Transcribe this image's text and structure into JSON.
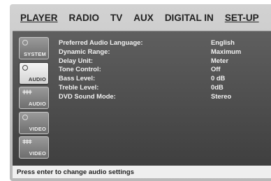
{
  "menu": {
    "items": [
      "PLAYER",
      "RADIO",
      "TV",
      "AUX",
      "DIGITAL IN"
    ],
    "active": "SET-UP"
  },
  "sidebar": {
    "tiles": [
      {
        "label": "SYSTEM",
        "icon": "knob-icon",
        "selected": false
      },
      {
        "label": "AUDIO",
        "icon": "knob-icon",
        "selected": true
      },
      {
        "label": "AUDIO",
        "icon": "equalizer-icon",
        "selected": false
      },
      {
        "label": "VIDEO",
        "icon": "knob-icon",
        "selected": false
      },
      {
        "label": "VIDEO",
        "icon": "equalizer-icon",
        "selected": false
      }
    ]
  },
  "settings": [
    {
      "label": "Preferred Audio Language:",
      "value": "English"
    },
    {
      "label": "Dynamic Range:",
      "value": "Maximum"
    },
    {
      "label": "Delay Unit:",
      "value": "Meter"
    },
    {
      "label": "Tone Control:",
      "value": "Off"
    },
    {
      "label": "Bass Level:",
      "value": "0 dB"
    },
    {
      "label": "Treble Level:",
      "value": "0dB"
    },
    {
      "label": "DVD Sound Mode:",
      "value": "Stereo"
    }
  ],
  "status": {
    "text": "Press enter to change audio settings"
  },
  "colors": {
    "panel": "#4f4f4f",
    "frame": "#c6c6c6",
    "text": "#f2f2f2"
  }
}
